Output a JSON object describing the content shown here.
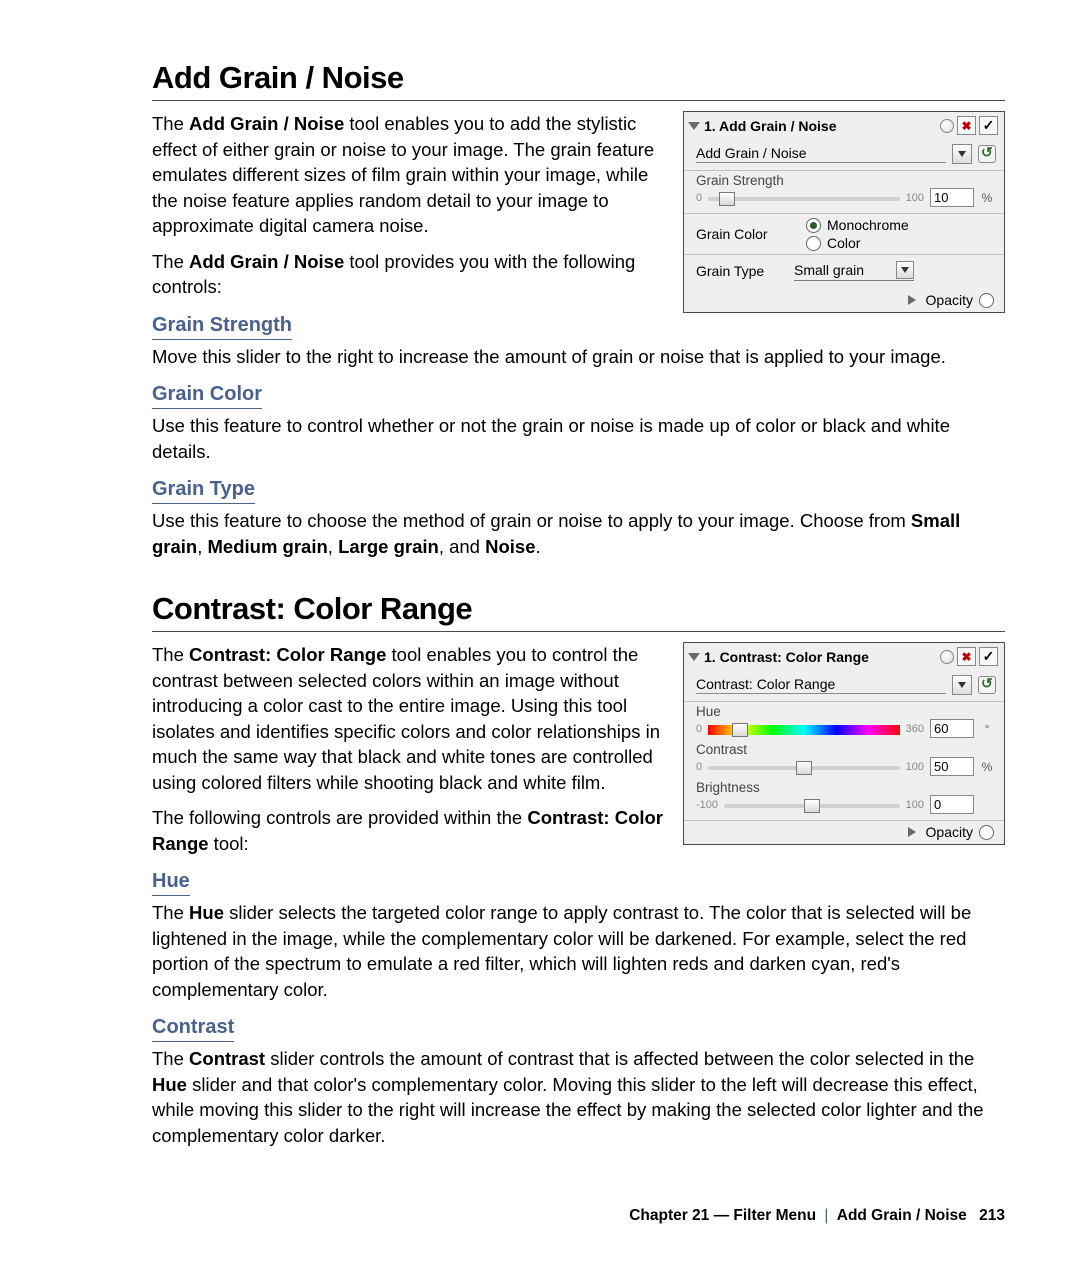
{
  "section1": {
    "title": "Add Grain / Noise",
    "p1_before": "The ",
    "p1_b1": "Add Grain / Noise",
    "p1_after": " tool enables you to add the stylistic effect of either grain or noise to your image. The grain feature emulates different sizes of film grain within your image, while the noise feature applies random detail to your image to approximate digital camera noise.",
    "p2_before": "The ",
    "p2_b": "Add Grain / Noise",
    "p2_after": " tool provides you with the following controls:",
    "sub_strength": "Grain Strength",
    "p_strength": "Move this slider to the right to increase the amount of grain or noise that is applied to your image.",
    "sub_color": "Grain Color",
    "p_color": "Use this feature to control whether or not the grain or noise is made up of color or black and white details.",
    "sub_type": "Grain Type",
    "p_type_before": "Use this feature to choose the method of grain or noise to apply to your image. Choose from ",
    "p_type_b1": "Small grain",
    "p_type_b2": "Medium grain",
    "p_type_b3": "Large grain",
    "p_type_b4": "Noise",
    "p_type_sep1": ", ",
    "p_type_sep2": ", ",
    "p_type_sep3": ", and ",
    "p_type_end": "."
  },
  "panel1": {
    "header": "1. Add Grain / Noise",
    "preset": "Add Grain / Noise",
    "strength_label": "Grain Strength",
    "strength_min": "0",
    "strength_max": "100",
    "strength_val": "10",
    "strength_unit": "%",
    "gc_label": "Grain Color",
    "gc_opt1": "Monochrome",
    "gc_opt2": "Color",
    "gt_label": "Grain Type",
    "gt_value": "Small grain",
    "opacity": "Opacity"
  },
  "section2": {
    "title": "Contrast: Color Range",
    "p1_before": "The ",
    "p1_b1": "Contrast: Color Range",
    "p1_after": " tool enables you to control the contrast between selected colors within an image without introducing a color cast to the entire image. Using this tool isolates and identifies specific colors and color relationships in much the same way that black and white tones are controlled using colored filters while shooting black and white film.",
    "p2_before": "The following controls are provided within the ",
    "p2_b": "Contrast: Color Range",
    "p2_after": " tool:",
    "sub_hue": "Hue",
    "p_hue_before": "The ",
    "p_hue_b": "Hue",
    "p_hue_after": " slider selects the targeted color range to apply contrast to. The color that is selected will be lightened in the image, while the complementary color will be darkened. For example, select the red portion of the spectrum to emulate a red filter, which will lighten reds and darken cyan, red's complementary color.",
    "sub_contrast": "Contrast",
    "p_contrast_a": "The ",
    "p_contrast_b1": "Contrast",
    "p_contrast_c": " slider controls the amount of contrast that is affected between the color selected in the ",
    "p_contrast_b2": "Hue",
    "p_contrast_d": " slider and that color's complementary color. Moving this slider to the left will decrease this effect, while moving this slider to the right will increase the effect by making the selected color lighter and the complementary color darker."
  },
  "panel2": {
    "header": "1. Contrast: Color Range",
    "preset": "Contrast: Color Range",
    "hue_label": "Hue",
    "hue_min": "0",
    "hue_max": "360",
    "hue_val": "60",
    "hue_unit": "°",
    "con_label": "Contrast",
    "con_min": "0",
    "con_max": "100",
    "con_val": "50",
    "con_unit": "%",
    "bri_label": "Brightness",
    "bri_min": "-100",
    "bri_max": "100",
    "bri_val": "0",
    "opacity": "Opacity"
  },
  "footer": {
    "chapter": "Chapter 21 — Filter Menu",
    "crumb": "Add Grain / Noise",
    "page": "213"
  }
}
